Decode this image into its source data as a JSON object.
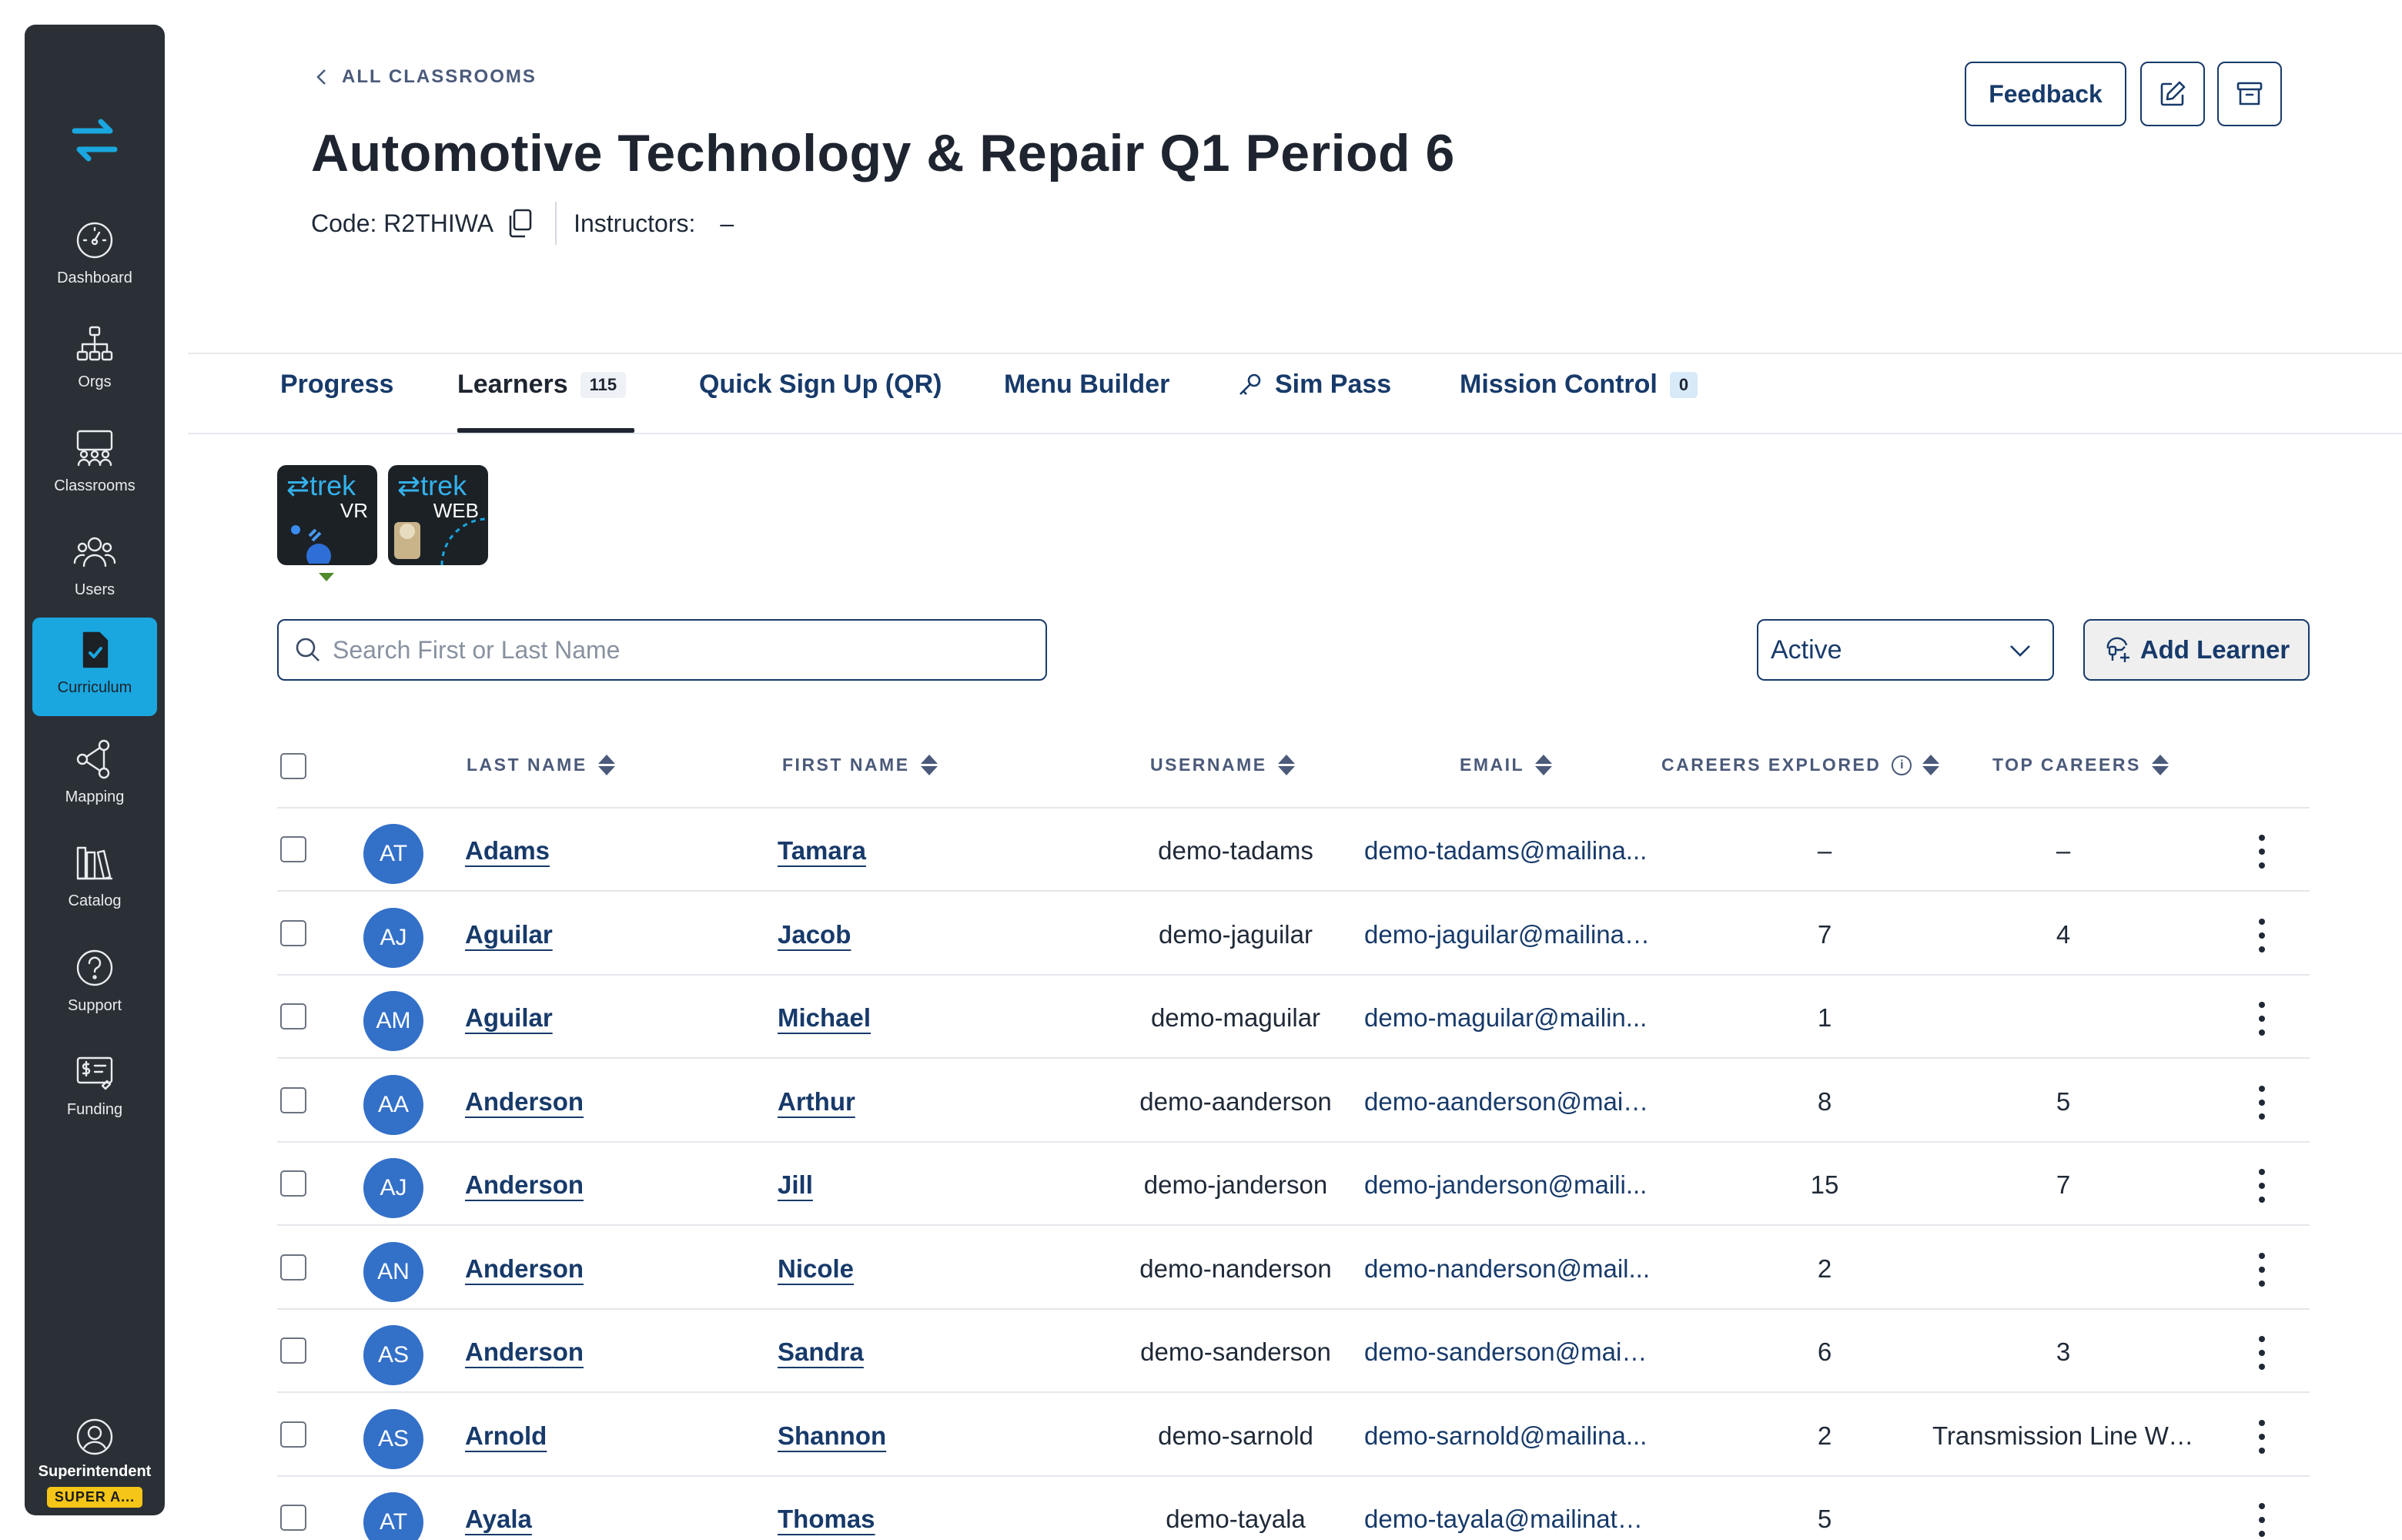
{
  "sidebar": {
    "items": [
      {
        "label": "Dashboard",
        "icon": "gauge-icon"
      },
      {
        "label": "Orgs",
        "icon": "org-chart-icon"
      },
      {
        "label": "Classrooms",
        "icon": "classroom-icon"
      },
      {
        "label": "Users",
        "icon": "users-icon"
      },
      {
        "label": "Curriculum",
        "icon": "curriculum-icon"
      },
      {
        "label": "Mapping",
        "icon": "mapping-icon"
      },
      {
        "label": "Catalog",
        "icon": "catalog-icon"
      },
      {
        "label": "Support",
        "icon": "help-icon"
      },
      {
        "label": "Funding",
        "icon": "funding-icon"
      }
    ],
    "active": "Curriculum",
    "user": {
      "name": "Superintendent",
      "badge": "SUPER A..."
    }
  },
  "header": {
    "breadcrumb": "ALL CLASSROOMS",
    "title": "Automotive Technology & Repair Q1 Period 6",
    "code": "Code: R2THIWA",
    "instructors_label": "Instructors:",
    "instructors_value": "–",
    "feedback_label": "Feedback"
  },
  "tabs": [
    {
      "label": "Progress"
    },
    {
      "label": "Learners",
      "count": "115",
      "active": true
    },
    {
      "label": "Quick Sign Up (QR)"
    },
    {
      "label": "Menu Builder"
    },
    {
      "label": "Sim Pass",
      "icon": "key-icon"
    },
    {
      "label": "Mission Control",
      "count": "0"
    }
  ],
  "products": [
    {
      "brand": "⇄trek",
      "type": "VR"
    },
    {
      "brand": "⇄trek",
      "type": "WEB"
    }
  ],
  "search": {
    "placeholder": "Search First or Last Name",
    "value": ""
  },
  "status_filter": {
    "selected": "Active"
  },
  "add_learner_label": "Add Learner",
  "table": {
    "columns": [
      "LAST NAME",
      "FIRST NAME",
      "USERNAME",
      "EMAIL",
      "CAREERS EXPLORED",
      "TOP CAREERS"
    ],
    "rows": [
      {
        "initials": "AT",
        "last": "Adams",
        "first": "Tamara",
        "username": "demo-tadams",
        "email": "demo-tadams@mailina...",
        "careers": "–",
        "top": "–"
      },
      {
        "initials": "AJ",
        "last": "Aguilar",
        "first": "Jacob",
        "username": "demo-jaguilar",
        "email": "demo-jaguilar@mailinat...",
        "careers": "7",
        "top": "4"
      },
      {
        "initials": "AM",
        "last": "Aguilar",
        "first": "Michael",
        "username": "demo-maguilar",
        "email": "demo-maguilar@mailin...",
        "careers": "1",
        "top": ""
      },
      {
        "initials": "AA",
        "last": "Anderson",
        "first": "Arthur",
        "username": "demo-aanderson",
        "email": "demo-aanderson@maili...",
        "careers": "8",
        "top": "5"
      },
      {
        "initials": "AJ",
        "last": "Anderson",
        "first": "Jill",
        "username": "demo-janderson",
        "email": "demo-janderson@maili...",
        "careers": "15",
        "top": "7"
      },
      {
        "initials": "AN",
        "last": "Anderson",
        "first": "Nicole",
        "username": "demo-nanderson",
        "email": "demo-nanderson@mail...",
        "careers": "2",
        "top": ""
      },
      {
        "initials": "AS",
        "last": "Anderson",
        "first": "Sandra",
        "username": "demo-sanderson",
        "email": "demo-sanderson@maili...",
        "careers": "6",
        "top": "3"
      },
      {
        "initials": "AS",
        "last": "Arnold",
        "first": "Shannon",
        "username": "demo-sarnold",
        "email": "demo-sarnold@mailina...",
        "careers": "2",
        "top": "Transmission Line Work..."
      },
      {
        "initials": "AT",
        "last": "Ayala",
        "first": "Thomas",
        "username": "demo-tayala",
        "email": "demo-tayala@mailinato...",
        "careers": "5",
        "top": ""
      }
    ]
  },
  "colors": {
    "sidebar_bg": "#2b3036",
    "active_nav": "#1aa7e0",
    "primary": "#173a6a",
    "avatar": "#3370c8",
    "badge": "#f5c518"
  }
}
